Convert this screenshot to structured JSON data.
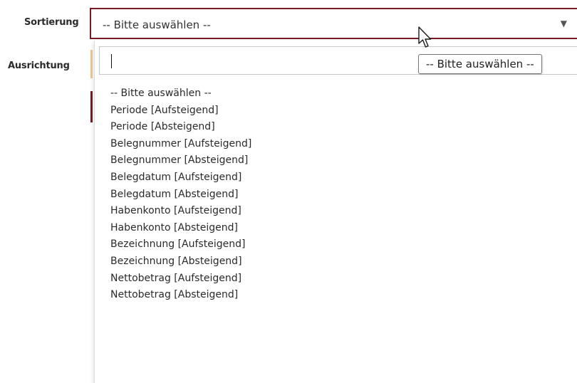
{
  "form": {
    "sortierung_label": "Sortierung",
    "ausrichtung_label": "Ausrichtung"
  },
  "select": {
    "value": "-- Bitte auswählen --",
    "arrow_icon": "dropdown-arrow-icon"
  },
  "dropdown": {
    "search_value": "",
    "tooltip": "-- Bitte auswählen --",
    "options": [
      "-- Bitte auswählen --",
      "Periode [Aufsteigend]",
      "Periode [Absteigend]",
      "Belegnummer [Aufsteigend]",
      "Belegnummer [Absteigend]",
      "Belegdatum [Aufsteigend]",
      "Belegdatum [Absteigend]",
      "Habenkonto [Aufsteigend]",
      "Habenkonto [Absteigend]",
      "Bezeichnung [Aufsteigend]",
      "Bezeichnung [Absteigend]",
      "Nettobetrag [Aufsteigend]",
      "Nettobetrag [Absteigend]"
    ]
  },
  "colors": {
    "select_border": "#7a1a24",
    "accent_orange": "#f2c88a"
  }
}
